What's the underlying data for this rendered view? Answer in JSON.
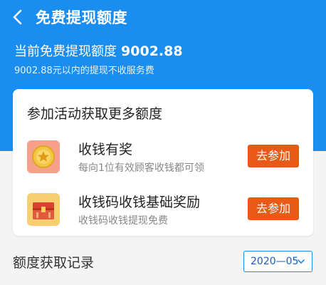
{
  "header": {
    "title": "免费提现额度",
    "back_icon": "back-arrow-icon",
    "quota_label": "当前免费提现额度",
    "quota_amount": "9002.88",
    "quota_note": "9002.88元以内的提现不收服务费"
  },
  "activities": {
    "title": "参加活动获取更多额度",
    "items": [
      {
        "name": "收钱有奖",
        "desc": "每向1位有效顾客收钱都可领",
        "button": "去参加",
        "icon": "medal-coin-icon"
      },
      {
        "name": "收钱码收钱基础奖励",
        "desc": "收钱码收钱提现免费",
        "button": "去参加",
        "icon": "treasure-chest-icon"
      }
    ]
  },
  "records": {
    "title": "额度获取记录",
    "month_selected": "2020—05"
  },
  "colors": {
    "primary": "#1a8ef0",
    "button": "#e85a16"
  }
}
